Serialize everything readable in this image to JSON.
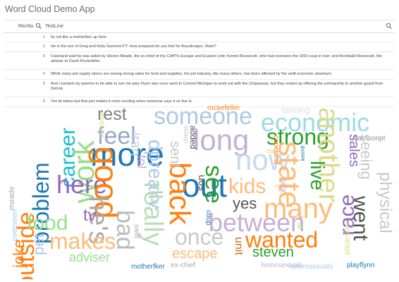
{
  "app": {
    "title": "Word Cloud Demo App"
  },
  "table": {
    "columns": [
      "RecNo",
      "TextLine"
    ],
    "rows": [
      {
        "no": "1",
        "text": "Its not like a motherfker up here."
      },
      {
        "no": "2",
        "text": "He is the son of Greg and Kelly Garrison.PT: How prepared do you feel for Boys&rsquo; State?"
      },
      {
        "no": "3",
        "text": "Copeland said he was aided by Steven Meade, the ex-chief of the CIA¶?s Escape and Evasion Unit; Kermit Roosevelt, who had overseen the 1953 coup in Iran; and Archibald Roosevelt, the adviser to David Rockefeller."
      },
      {
        "no": "4",
        "text": "While many pet supply stores are seeing strong sales for food and supplies, the pet industry, like many others, has been affected by the swift economic downturn."
      },
      {
        "no": "5",
        "text": "And I wanted my parents to be able to see me play Flynn also once went to Central Michigan to work out with the Chippewas, but they ended up offering the scholarship to another guard from Detroit."
      },
      {
        "no": "6",
        "text": "Yes its taboo but that just makes it more exciting when someone says it on live tv."
      }
    ]
  },
  "cloud": {
    "words": [
      {
        "t": "rest",
        "c": "#7f7f7f"
      },
      {
        "t": "someone",
        "c": "#aec7e8"
      },
      {
        "t": "rockefeller",
        "c": "#ff7f0e"
      },
      {
        "t": "tanning",
        "c": "#dcdcdc"
      },
      {
        "t": "economic",
        "c": "#9edae5"
      },
      {
        "t": "feel",
        "c": "#98a8c8"
      },
      {
        "t": "strong",
        "c": "#2ca02c"
      },
      {
        "t": "garrisonpt",
        "c": "#8c8c8c"
      },
      {
        "t": "more",
        "c": "#1f77b4"
      },
      {
        "t": "long",
        "c": "#c5b0d5"
      },
      {
        "t": "now",
        "c": "#c6dbef"
      },
      {
        "t": "outside",
        "c": "#ff7f0e"
      },
      {
        "t": "career",
        "c": "#17becf"
      },
      {
        "t": "work",
        "c": "#98df8a"
      },
      {
        "t": "iran",
        "c": "#bcd4e6"
      },
      {
        "t": "out",
        "c": "#1f77b4"
      },
      {
        "t": "state",
        "c": "#ffbb78"
      },
      {
        "t": "another",
        "c": "#dbdb8d"
      },
      {
        "t": "seeing",
        "c": "#c7c7c7"
      },
      {
        "t": "sales",
        "c": "#9467bd"
      },
      {
        "t": "problem",
        "c": "#1f77b4"
      },
      {
        "t": "here",
        "c": "#9467bd"
      },
      {
        "t": "good",
        "c": "#ff7f0e"
      },
      {
        "t": "dpreally",
        "c": "#aec7e8"
      },
      {
        "t": "back",
        "c": "#ff7f0e"
      },
      {
        "t": "see",
        "c": "#2ca02c"
      },
      {
        "t": "kids",
        "c": "#ffbb78"
      },
      {
        "t": "live",
        "c": "#2ca02c"
      },
      {
        "t": "physical",
        "c": "#c7c7c7"
      },
      {
        "t": "many",
        "c": "#ffbb78"
      },
      {
        "t": "yes",
        "c": "#555555"
      },
      {
        "t": "went",
        "c": "#555555"
      },
      {
        "t": "food",
        "c": "#98df8a"
      },
      {
        "t": "he's",
        "c": "#aaaaaa"
      },
      {
        "t": "tv",
        "c": "#9467bd"
      },
      {
        "t": "bad",
        "c": "#bbbbbb"
      },
      {
        "t": "really",
        "c": "#bcdcbc"
      },
      {
        "t": "between",
        "c": "#c5b0d5"
      },
      {
        "t": "makes",
        "c": "#ffbb78"
      },
      {
        "t": "once",
        "c": "#c9c9c9"
      },
      {
        "t": "wanted",
        "c": "#ff7f0e"
      },
      {
        "t": "race",
        "c": "#9467bd"
      },
      {
        "t": "joke",
        "c": "#ff7f0e"
      },
      {
        "t": "pet",
        "c": "#aec7e8"
      },
      {
        "t": "adviser",
        "c": "#98df8a"
      },
      {
        "t": "escape",
        "c": "#ffbb78"
      },
      {
        "t": "steven",
        "c": "#2ca02c"
      },
      {
        "t": "unit",
        "c": "#d2691e"
      },
      {
        "t": "motherfker",
        "c": "#1f77b4"
      },
      {
        "t": "ex-chief",
        "c": "#aaaaaa"
      },
      {
        "t": "homosexuals",
        "c": "#c5b0d5"
      },
      {
        "t": "heterosexuals",
        "c": "#aec7e8"
      },
      {
        "t": "playflynn",
        "c": "#1f77b4"
      },
      {
        "t": "a",
        "c": "#98df8a"
      },
      {
        "t": "attraction",
        "c": "#dbdb8d"
      },
      {
        "t": "meade",
        "c": "#aaaaaa"
      },
      {
        "t": "overseen",
        "c": "#aec7e8"
      },
      {
        "t": "archibald",
        "c": "#dbdb8d"
      },
      {
        "t": "added",
        "c": "#555555"
      },
      {
        "t": "elision",
        "c": "#c7c7c7"
      },
      {
        "t": "sent",
        "c": "#c7c7c7"
      },
      {
        "t": "uos",
        "c": "#555555"
      },
      {
        "t": "coup",
        "c": "#1f77b4"
      },
      {
        "t": "copeland",
        "c": "#ff7f0e"
      },
      {
        "t": "cia",
        "c": "#ffbb78"
      },
      {
        "t": "sex",
        "c": "#c5b0d5"
      },
      {
        "t": "swift",
        "c": "#aaaaaa"
      },
      {
        "t": "kermit",
        "c": "#1f77b4"
      },
      {
        "t": "tol",
        "c": "#c5b0d5"
      },
      {
        "t": "radio",
        "c": "#ffbb78"
      }
    ]
  }
}
